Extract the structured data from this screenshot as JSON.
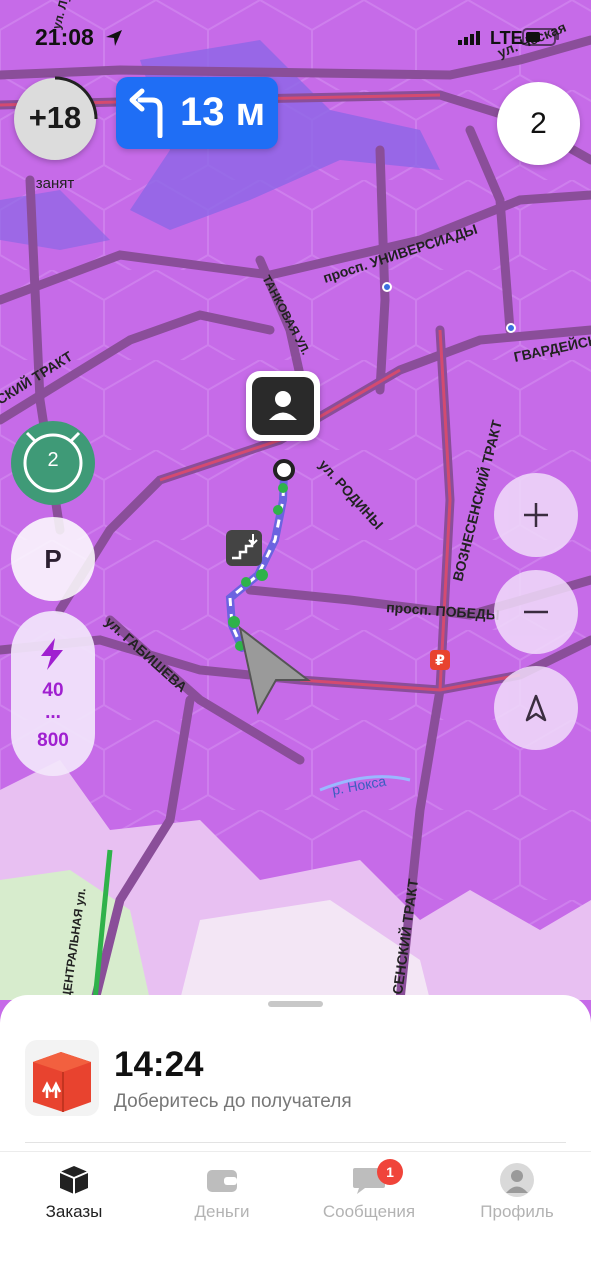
{
  "status_bar": {
    "time": "21:08",
    "network": "LTE",
    "icons": [
      "location-arrow-icon",
      "signal-icon",
      "battery-icon"
    ]
  },
  "map": {
    "street_labels": [
      "ул. Луначарского",
      "ул. Ческая",
      "просп. УНИВЕРСИАДЫ",
      "ГВАРДЕЙСК",
      "СКИЙ ТРАКТ",
      "ТАНКОВАЯ УЛ.",
      "ул. РОДИНЫ",
      "ВОЗНЕСЕНСКИЙ ТРАКТ",
      "просп. ПОБЕДЫ",
      "ул. ГАБИШЕВА",
      "р. Нокса",
      "СЕНСКИЙ ТРАКТ",
      "ЦЕНТРАЛЬНАЯ ул."
    ],
    "colors": {
      "surge_zone": "#c66be8",
      "route": "#6b63e0",
      "traffic_green": "#2fb24a",
      "road": "#8a5a9a",
      "traffic_red": "#e04a6a"
    }
  },
  "karma": {
    "value": "+18",
    "status_label": "занят"
  },
  "maneuver": {
    "distance": "13 м",
    "icon": "turn-left-icon",
    "color": "#1f6ef5"
  },
  "orders_counter": "2",
  "surge": {
    "value": "2",
    "color": "#3f9a77"
  },
  "parking": {
    "label": "P"
  },
  "power": {
    "min": "40",
    "dots": "...",
    "max": "800",
    "icon": "lightning-icon"
  },
  "controls": [
    "zoom-in-icon",
    "zoom-out-icon",
    "navigation-arrow-icon"
  ],
  "order": {
    "time": "14:24",
    "subtitle": "Доберитесь до получателя",
    "icon": "parcel-box-icon"
  },
  "tabs": [
    {
      "label": "Заказы",
      "icon": "orders-box-icon",
      "active": true
    },
    {
      "label": "Деньги",
      "icon": "wallet-icon",
      "active": false
    },
    {
      "label": "Сообщения",
      "icon": "chat-bubble-icon",
      "active": false,
      "badge": "1"
    },
    {
      "label": "Профиль",
      "icon": "avatar-icon",
      "active": false
    }
  ]
}
